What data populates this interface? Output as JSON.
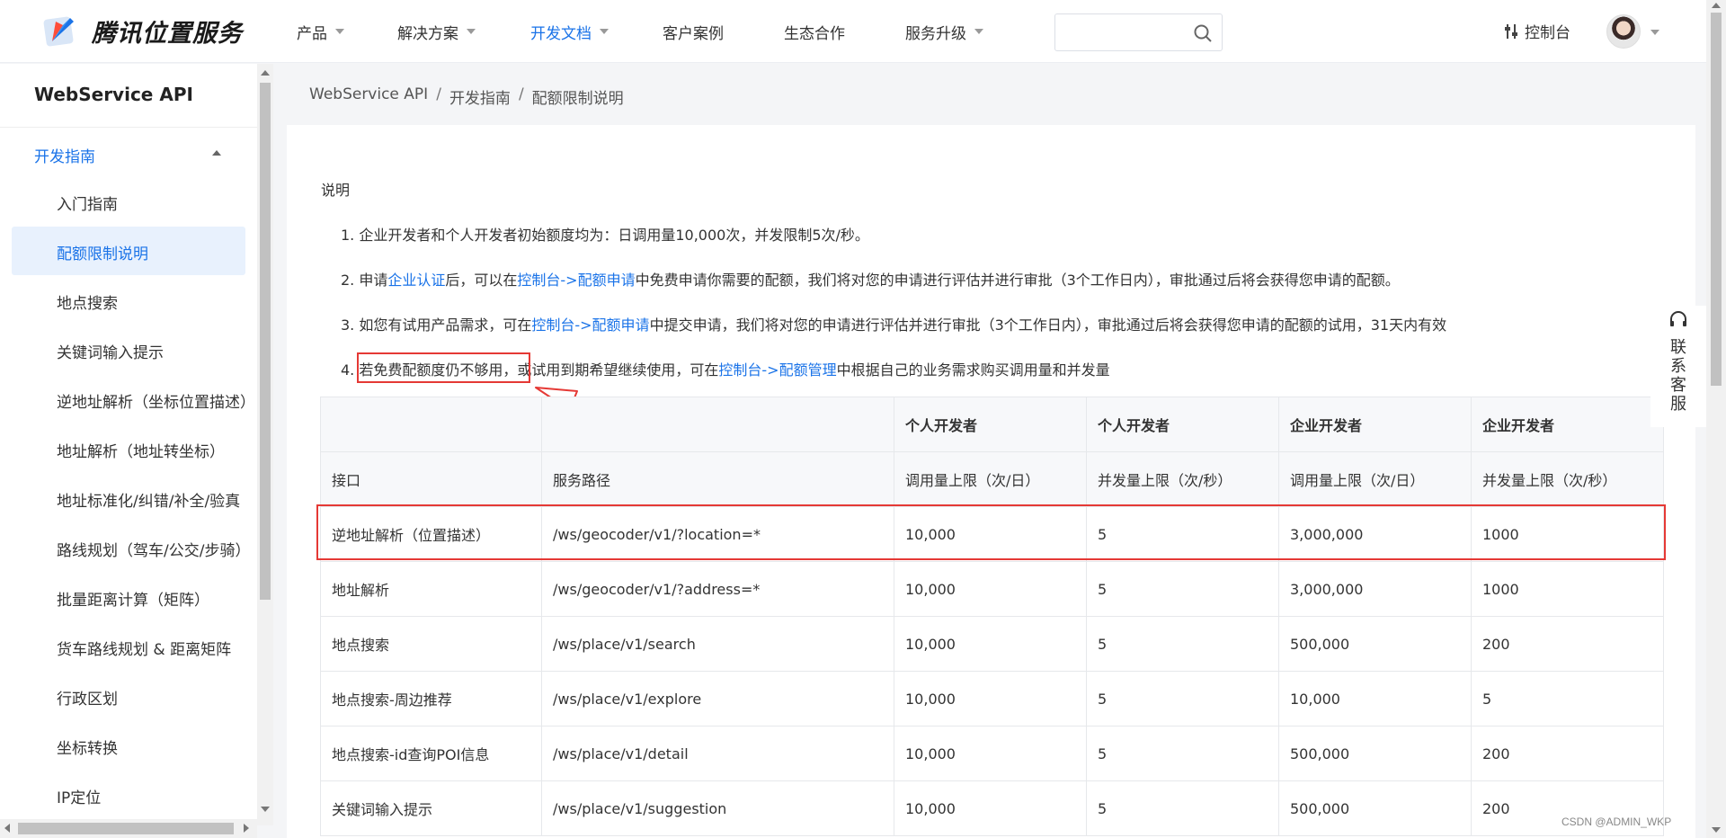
{
  "brand": {
    "name": "腾讯位置服务"
  },
  "nav": {
    "items": [
      {
        "label": "产品",
        "has_caret": true
      },
      {
        "label": "解决方案",
        "has_caret": true
      },
      {
        "label": "开发文档",
        "has_caret": true,
        "active": true
      },
      {
        "label": "客户案例",
        "has_caret": false
      },
      {
        "label": "生态合作",
        "has_caret": false
      },
      {
        "label": "服务升级",
        "has_caret": true
      }
    ],
    "search_placeholder": "",
    "console_label": "控制台"
  },
  "sidebar": {
    "title": "WebService API",
    "section": "开发指南",
    "items": [
      {
        "label": "入门指南"
      },
      {
        "label": "配额限制说明",
        "active": true
      },
      {
        "label": "地点搜索"
      },
      {
        "label": "关键词输入提示"
      },
      {
        "label": "逆地址解析（坐标位置描述）"
      },
      {
        "label": "地址解析（地址转坐标）"
      },
      {
        "label": "地址标准化/纠错/补全/验真"
      },
      {
        "label": "路线规划（驾车/公交/步骑）"
      },
      {
        "label": "批量距离计算（矩阵）"
      },
      {
        "label": "货车路线规划 & 距离矩阵"
      },
      {
        "label": "行政区划"
      },
      {
        "label": "坐标转换"
      },
      {
        "label": "IP定位"
      }
    ]
  },
  "breadcrumb": [
    "WebService API",
    "开发指南",
    "配额限制说明"
  ],
  "content": {
    "desc_title": "说明",
    "item1": "1. 企业开发者和个人开发者初始额度均为：日调用量10,000次，并发限制5次/秒。",
    "item2": {
      "num": "2.",
      "p1": "申请",
      "link1": "企业认证",
      "p2": "后，可以在",
      "link2": "控制台->配额申请",
      "p3": "中免费申请你需要的配额，我们将对您的申请进行评估并进行审批（3个工作日内），审批通过后将会获得您申请的配额。"
    },
    "item3": {
      "num": "3.",
      "p1": "如您有试用产品需求，可在",
      "link1": "控制台->配额申请",
      "p2": "中提交申请，我们将对您的申请进行评估并进行审批（3个工作日内），审批通过后将会获得您申请的配额的试用，31天内有效"
    },
    "item4": {
      "num": "4.",
      "p1": "若免费配额度仍不够用，",
      "p2": "或试用到期希望继续使用，可在",
      "link1": "控制台->配额管理",
      "p3": "中根据自己的业务需求购买调用量和并发量"
    }
  },
  "table": {
    "header1": [
      "",
      "",
      "个人开发者",
      "个人开发者",
      "企业开发者",
      "企业开发者"
    ],
    "header2": [
      "接口",
      "服务路径",
      "调用量上限（次/日）",
      "并发量上限（次/秒）",
      "调用量上限（次/日）",
      "并发量上限（次/秒）"
    ],
    "rows": [
      [
        "逆地址解析（位置描述）",
        "/ws/geocoder/v1/?location=*",
        "10,000",
        "5",
        "3,000,000",
        "1000"
      ],
      [
        "地址解析",
        "/ws/geocoder/v1/?address=*",
        "10,000",
        "5",
        "3,000,000",
        "1000"
      ],
      [
        "地点搜索",
        "/ws/place/v1/search",
        "10,000",
        "5",
        "500,000",
        "200"
      ],
      [
        "地点搜索-周边推荐",
        "/ws/place/v1/explore",
        "10,000",
        "5",
        "10,000",
        "5"
      ],
      [
        "地点搜索-id查询POI信息",
        "/ws/place/v1/detail",
        "10,000",
        "5",
        "500,000",
        "200"
      ],
      [
        "关键词输入提示",
        "/ws/place/v1/suggestion",
        "10,000",
        "5",
        "500,000",
        "200"
      ]
    ]
  },
  "widget": {
    "label": "联系客服"
  },
  "watermark": "CSDN @ADMIN_WKP",
  "colors": {
    "accent": "#1a73e8",
    "highlight": "#e53935"
  }
}
